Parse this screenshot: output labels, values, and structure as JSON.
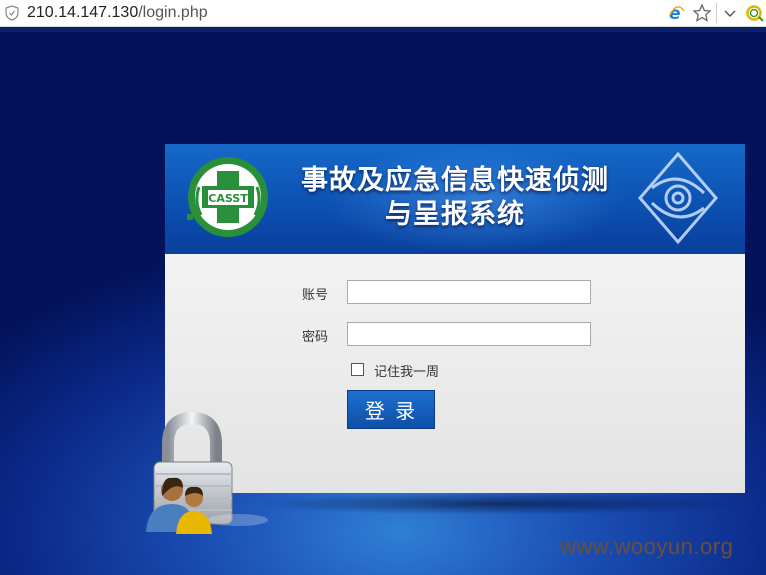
{
  "browser": {
    "url_host": "210.14.147.130",
    "url_path": "/login.php",
    "icons": [
      "shield-icon",
      "ie-icon",
      "star-icon",
      "chevron-down-icon",
      "extension-icon"
    ]
  },
  "banner": {
    "logo_text": "CASST",
    "title_line1": "事故及应急信息快速侦测",
    "title_line2": "与呈报系统"
  },
  "form": {
    "account_label": "账号",
    "account_value": "",
    "password_label": "密码",
    "password_value": "",
    "remember_label": "记住我一周",
    "remember_checked": false,
    "login_button": "登 录"
  },
  "watermark": "www.wooyun.org",
  "colors": {
    "background": "#0a2a80",
    "banner": "#0b4fb0",
    "button": "#0e4fa8",
    "logo_green": "#2a8f3a"
  }
}
